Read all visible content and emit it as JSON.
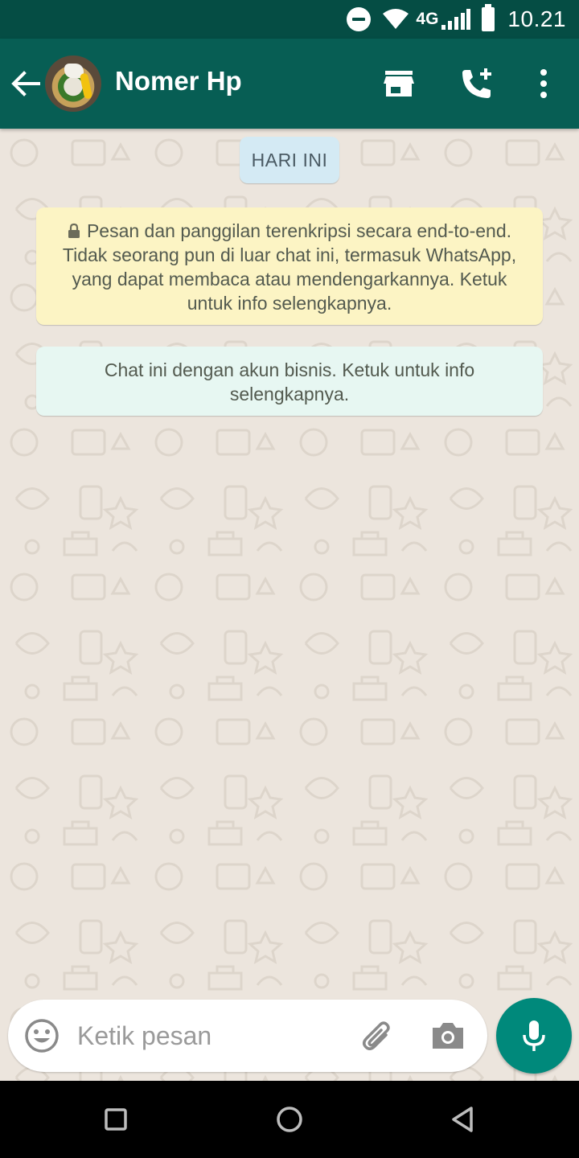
{
  "status_bar": {
    "network": "4G",
    "time": "10.21"
  },
  "toolbar": {
    "title": "Nomer Hp",
    "icons": [
      "back-arrow-icon",
      "store-icon",
      "add-call-icon",
      "more-vert-icon"
    ]
  },
  "chat": {
    "date_chip": "HARI INI",
    "encryption_notice": "Pesan dan panggilan terenkripsi secara end-to-end. Tidak seorang pun di luar chat ini, termasuk WhatsApp, yang dapat membaca atau mendengarkannya. Ketuk untuk info selengkapnya.",
    "business_notice": "Chat ini dengan akun bisnis. Ketuk untuk info selengkapnya."
  },
  "input": {
    "placeholder": "Ketik pesan",
    "value": ""
  },
  "colors": {
    "status_bar": "#054d44",
    "toolbar": "#075e54",
    "chat_background": "#ece5dd",
    "date_chip": "#d4eaf4",
    "encryption_notice": "#fcf4c4",
    "business_notice": "#e7f7f2",
    "mic_button": "#00897b"
  }
}
